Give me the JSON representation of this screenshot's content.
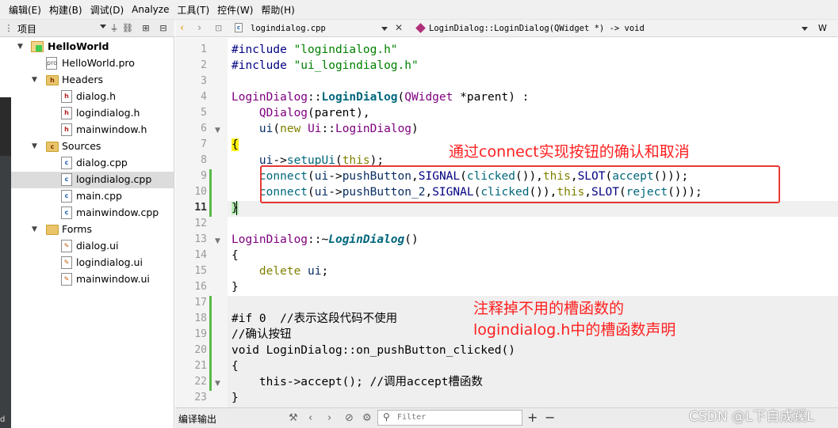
{
  "menu": [
    "编辑(E)",
    "构建(B)",
    "调试(D)",
    "Analyze",
    "工具(T)",
    "控件(W)",
    "帮助(H)"
  ],
  "projects_panel": {
    "title": "项目",
    "tree": [
      {
        "label": "HelloWorld",
        "bold": true
      },
      {
        "label": "HelloWorld.pro"
      },
      {
        "label": "Headers"
      },
      {
        "label": "dialog.h"
      },
      {
        "label": "logindialog.h"
      },
      {
        "label": "mainwindow.h"
      },
      {
        "label": "Sources"
      },
      {
        "label": "dialog.cpp"
      },
      {
        "label": "logindialog.cpp",
        "selected": true
      },
      {
        "label": "main.cpp"
      },
      {
        "label": "mainwindow.cpp"
      },
      {
        "label": "Forms"
      },
      {
        "label": "dialog.ui"
      },
      {
        "label": "logindialog.ui"
      },
      {
        "label": "mainwindow.ui"
      }
    ],
    "side_text": "d"
  },
  "editor_toolbar": {
    "file": "logindialog.cpp",
    "symbol": "LoginDialog::LoginDialog(QWidget *) -> void",
    "right_label": "W"
  },
  "code": {
    "line_numbers": [
      "1",
      "2",
      "3",
      "4",
      "5",
      "6",
      "7",
      "8",
      "9",
      "10",
      "11",
      "12",
      "13",
      "14",
      "15",
      "16",
      "17",
      "18",
      "19",
      "20",
      "21",
      "22",
      "23"
    ],
    "current_line": "11"
  },
  "annotations": {
    "connect_note": "通过connect实现按钮的确认和取消",
    "slot_note_line1": "注释掉不用的槽函数的",
    "slot_note_line2": "logindialog.h中的槽函数声明"
  },
  "bottom": {
    "output_title": "编译输出",
    "filter_placeholder": "Filter",
    "watermark": "CSDN @L下自成蹊L"
  }
}
